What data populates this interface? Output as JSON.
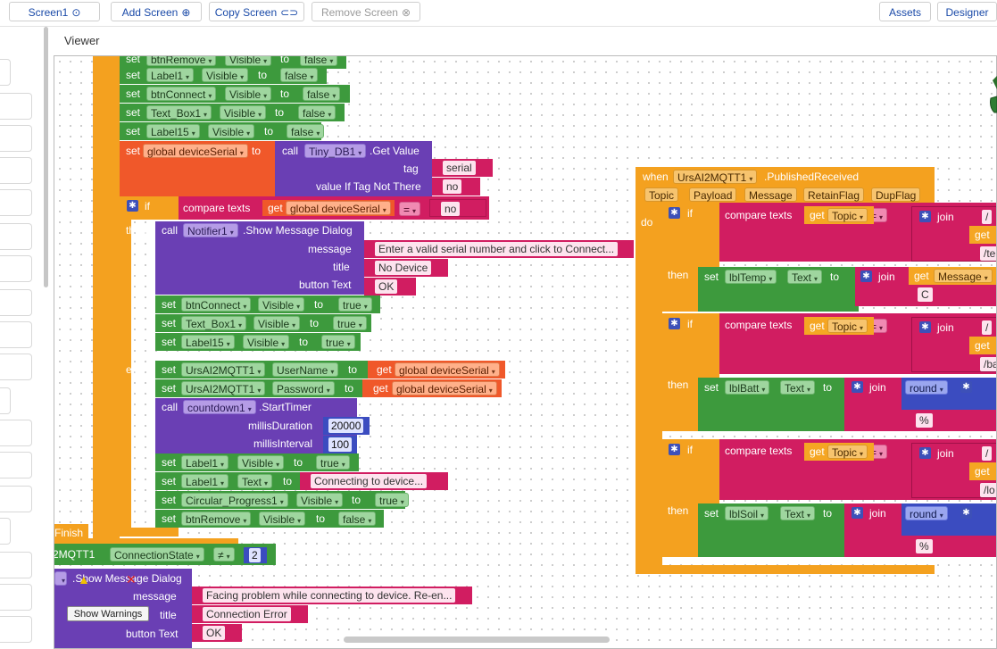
{
  "toolbar": {
    "screen": "Screen1",
    "add_screen": "Add Screen",
    "copy_screen": "Copy Screen",
    "remove_screen": "Remove Screen",
    "assets": "Assets",
    "designer": "Designer"
  },
  "viewer_label": "Viewer",
  "warnings_button": "Show Warnings",
  "left_blocks": {
    "btnremove": "btnRemove",
    "visible": "Visible",
    "to": "to",
    "false": "false",
    "true": "true",
    "set": "set",
    "label1": "Label1",
    "btnconnect": "btnConnect",
    "text_box1": "Text_Box1",
    "label15": "Label15",
    "global_deviceserial": "global deviceSerial",
    "call": "call",
    "tinydb": "Tiny_DB1",
    "getvalue": ".Get Value",
    "tag": "tag",
    "serial": "serial",
    "value_if": "value If Tag Not There",
    "no": "no",
    "if": "if",
    "compare_texts": "compare texts",
    "get": "get",
    "eq": "=",
    "then": "then",
    "else": "else",
    "notifier": "Notifier1",
    "show_dialog": ".Show Message Dialog",
    "message": "message",
    "title": "title",
    "button_text": "button Text",
    "msg_serial": "Enter a valid serial number and click to Connect...",
    "no_device": "No Device",
    "ok": "OK",
    "ursai": "UrsAI2MQTT1",
    "username": "UserName",
    "password": "Password",
    "countdown": "countdown1",
    "starttimer": ".StartTimer",
    "millis_duration": "millisDuration",
    "duration_val": "20000",
    "millis_interval": "millisInterval",
    "interval_val": "100",
    "text": "Text",
    "connecting": "Connecting to device...",
    "circular": "Circular_Progress1",
    "finish": "Finish",
    "mqtt_partial": "2MQTT1",
    "connection_state": "ConnectionState",
    "neq": "≠",
    "two": "2",
    "show_dialog2": ".Show Message Dialog",
    "msg_problem": "Facing problem while connecting to device. Re-en...",
    "connection_error": "Connection Error"
  },
  "right_blocks": {
    "when": "when",
    "ursai": "UrsAI2MQTT1",
    "published": ".PublishedReceived",
    "params": [
      "Topic",
      "Payload",
      "Message",
      "RetainFlag",
      "DupFlag"
    ],
    "do": "do",
    "if": "if",
    "then": "then",
    "compare_texts": "compare texts",
    "get": "get",
    "topic": "Topic",
    "eq": "=",
    "join": "join",
    "slash": "/",
    "te": "/te",
    "ba": "/ba",
    "lo": "/lo",
    "set": "set",
    "lbltemp": "lblTemp",
    "text": "Text",
    "to": "to",
    "message": "Message",
    "c": "C",
    "lblbatt": "lblBatt",
    "round": "round",
    "percent": "%",
    "lblsoil": "lblSoil"
  },
  "icons": [
    "target-icon",
    "plus-circle-icon",
    "copy-icon",
    "x-circle-icon",
    "gear-icon",
    "warning-icon",
    "error-icon",
    "trash-icon"
  ]
}
